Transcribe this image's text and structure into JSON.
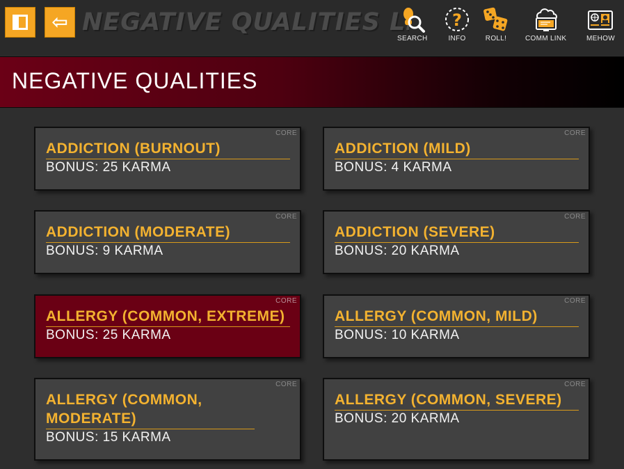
{
  "app": {
    "title": "NEGATIVE QUALITIES LIST",
    "sidebar_icon": "sidebar-toggle-icon",
    "back_icon": "back-arrow-icon"
  },
  "toolbar": {
    "search": {
      "label": "SEARCH",
      "icon": "search-icon"
    },
    "info": {
      "label": "INFO",
      "icon": "info-icon"
    },
    "roll": {
      "label": "ROLL!",
      "icon": "dice-icon"
    },
    "comm_link": {
      "label": "COMM LINK",
      "icon": "comm-link-icon"
    },
    "mehow": {
      "label": "MEHOW",
      "icon": "id-card-icon"
    }
  },
  "header": {
    "title": "NEGATIVE QUALITIES"
  },
  "qualities": [
    {
      "name": "ADDICTION (BURNOUT)",
      "bonus": "BONUS: 25 KARMA",
      "source": "CORE"
    },
    {
      "name": "ADDICTION (MILD)",
      "bonus": "BONUS: 4 KARMA",
      "source": "CORE"
    },
    {
      "name": "ADDICTION (MODERATE)",
      "bonus": "BONUS: 9 KARMA",
      "source": "CORE"
    },
    {
      "name": "ADDICTION (SEVERE)",
      "bonus": "BONUS: 20 KARMA",
      "source": "CORE"
    },
    {
      "name": "ALLERGY (COMMON, EXTREME)",
      "bonus": "BONUS: 25 KARMA",
      "source": "CORE"
    },
    {
      "name": "ALLERGY (COMMON, MILD)",
      "bonus": "BONUS: 10 KARMA",
      "source": "CORE"
    },
    {
      "name": "ALLERGY (COMMON, MODERATE)",
      "bonus": "BONUS: 15 KARMA",
      "source": "CORE"
    },
    {
      "name": "ALLERGY (COMMON, SEVERE)",
      "bonus": "BONUS: 20 KARMA",
      "source": "CORE"
    }
  ],
  "colors": {
    "accent": "#f5a623",
    "header_red": "#6b0016",
    "card_bg": "#414141",
    "selected_card_bg": "#6a0014",
    "name_gold": "#f3b230"
  }
}
